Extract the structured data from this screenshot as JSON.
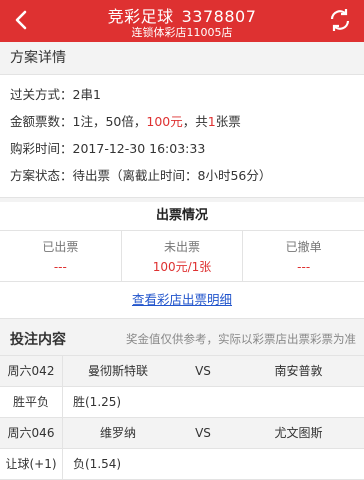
{
  "header": {
    "title": "竞彩足球",
    "order_no": "3378807",
    "store": "连锁体彩店11005店"
  },
  "plan": {
    "section_title": "方案详情",
    "pass_label": "过关方式：",
    "pass_value": "2串1",
    "amount_label": "金额票数：",
    "amount_part1": "1注，50倍，",
    "amount_money": "100元",
    "amount_part2": "，共",
    "amount_tickets": "1",
    "amount_part3": "张票",
    "time_label": "购彩时间：",
    "time_value": "2017-12-30 16:03:33",
    "status_label": "方案状态：",
    "status_value": "待出票（离截止时间：8小时56分）"
  },
  "ticket": {
    "title": "出票情况",
    "cells": [
      {
        "label": "已出票",
        "value": "---"
      },
      {
        "label": "未出票",
        "value": "100元/1张"
      },
      {
        "label": "已撤单",
        "value": "---"
      }
    ],
    "link": "查看彩店出票明细"
  },
  "bets": {
    "title": "投注内容",
    "note": "奖金值仅供参考，实际以彩票店出票彩票为准",
    "matches": [
      {
        "code": "周六042",
        "home": "曼彻斯特联",
        "vs": "VS",
        "away": "南安普敦",
        "play_type": "胜平负",
        "pick": "胜(1.25)"
      },
      {
        "code": "周六046",
        "home": "维罗纳",
        "vs": "VS",
        "away": "尤文图斯",
        "play_type": "让球(+1)",
        "pick": "负(1.54)"
      }
    ]
  },
  "icons": {
    "back": "chevron-left-icon",
    "refresh": "refresh-icon"
  },
  "colors": {
    "brand": "#de3131",
    "link": "#2255cc"
  }
}
